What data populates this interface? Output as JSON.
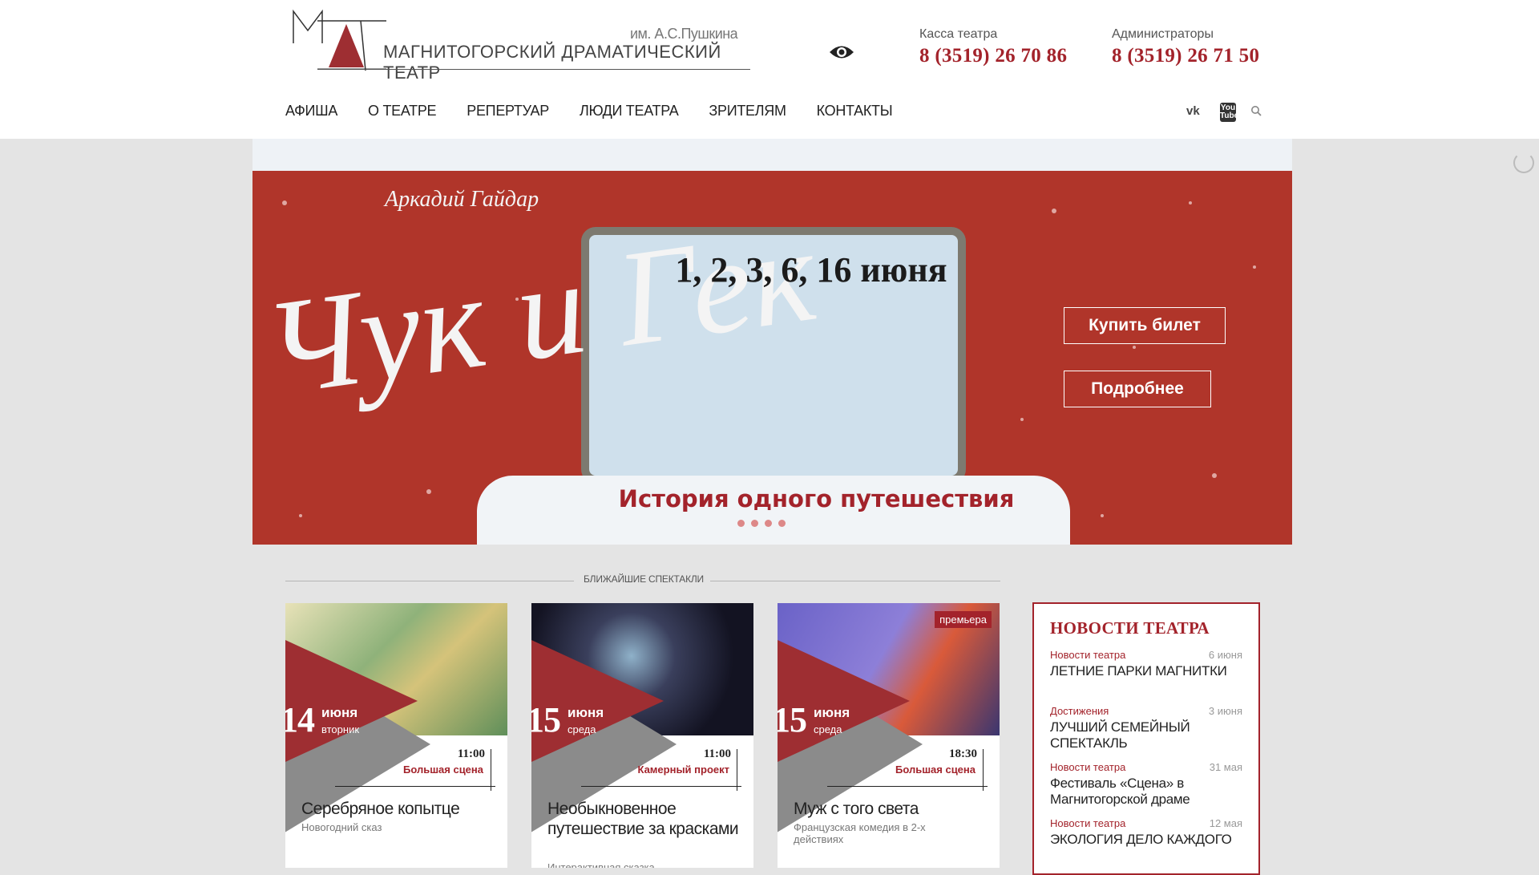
{
  "header": {
    "logo_sub": "им. А.С.Пушкина",
    "logo_main": "МАГНИТОГОРСКИЙ ДРАМАТИЧЕСКИЙ ТЕАТР",
    "accessibility_icon": "eye-icon",
    "phones": [
      {
        "label": "Касса театра",
        "number": "8 (3519) 26 70 86"
      },
      {
        "label": "Администраторы",
        "number": "8 (3519) 26 71 50"
      }
    ],
    "nav": [
      "АФИША",
      "О ТЕАТРЕ",
      "РЕПЕРТУАР",
      "ЛЮДИ ТЕАТРА",
      "ЗРИТЕЛЯМ",
      "КОНТАКТЫ"
    ],
    "social": {
      "vk": "vk",
      "youtube": "You Tube",
      "search_icon": "search-icon"
    }
  },
  "slider": {
    "author": "Аркадий Гайдар",
    "title": "Чук и Гек",
    "dates": "1, 2, 3, 6, 16 июня",
    "subtitle": "История одного путешествия",
    "buy_button": "Купить билет",
    "more_button": "Подробнее"
  },
  "section_title": "БЛИЖАЙШИЕ СПЕКТАКЛИ",
  "events": [
    {
      "day": "14",
      "month": "июня",
      "weekday": "вторник",
      "time": "11:00",
      "stage": "Большая сцена",
      "title": "Серебряное копытце",
      "genre": "Новогодний сказ",
      "badge": ""
    },
    {
      "day": "15",
      "month": "июня",
      "weekday": "среда",
      "time": "11:00",
      "stage": "Камерный проект",
      "title": "Необыкновенное путешествие за красками",
      "genre": "Интерактивная сказка",
      "badge": ""
    },
    {
      "day": "15",
      "month": "июня",
      "weekday": "среда",
      "time": "18:30",
      "stage": "Большая сцена",
      "title": "Муж с того света",
      "genre": "Французская комедия в 2-х действиях",
      "badge": "премьера"
    }
  ],
  "news": {
    "heading": "НОВОСТИ ТЕАТРА",
    "items": [
      {
        "category": "Новости театра",
        "date": "6 июня",
        "title": "ЛЕТНИЕ ПАРКИ МАГНИТКИ"
      },
      {
        "category": "Достижения",
        "date": "3 июня",
        "title": "ЛУЧШИЙ СЕМЕЙНЫЙ СПЕКТАКЛЬ"
      },
      {
        "category": "Новости театра",
        "date": "31 мая",
        "title": "Фестиваль «Сцена» в Магнитогорской драме"
      },
      {
        "category": "Новости театра",
        "date": "12 мая",
        "title": "ЭКОЛОГИЯ ДЕЛО КАЖДОГО"
      }
    ]
  },
  "colors": {
    "brand_red": "#a3232b",
    "slider_red": "#b0352a",
    "gray": "#8b8b8b"
  }
}
